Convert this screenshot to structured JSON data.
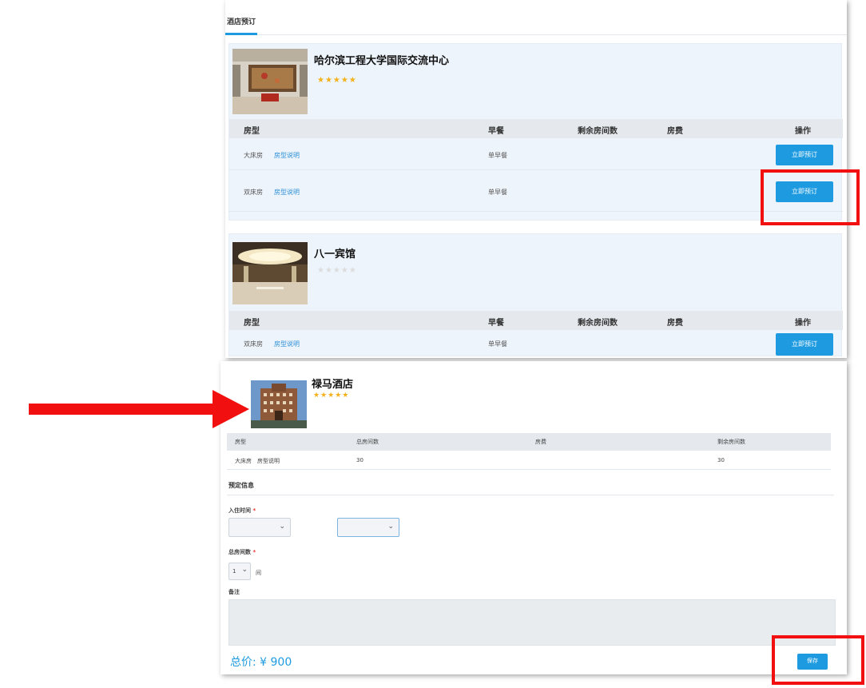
{
  "tabs": {
    "active": "酒店预订"
  },
  "room_columns": {
    "type": "房型",
    "breakfast": "早餐",
    "remaining": "剩余房间数",
    "price": "房费",
    "action": "操作"
  },
  "hotels": [
    {
      "name": "哈尔滨工程大学国际交流中心",
      "stars": "★★★★★",
      "rooms": [
        {
          "type": "大床房",
          "detail_link": "房型说明",
          "breakfast": "单早餐",
          "action": "立即预订"
        },
        {
          "type": "双床房",
          "detail_link": "房型说明",
          "breakfast": "单早餐",
          "action": "立即预订"
        }
      ]
    },
    {
      "name": "八一宾馆",
      "stars": "★★★★★",
      "rooms": [
        {
          "type": "双床房",
          "detail_link": "房型说明",
          "breakfast": "单早餐",
          "action": "立即预订"
        }
      ]
    }
  ],
  "booking": {
    "hotel_name": "禄马酒店",
    "stars": "★★★★★",
    "columns": {
      "type": "房型",
      "total": "总房间数",
      "price": "房费",
      "remaining": "剩余房间数"
    },
    "room": {
      "type": "大床房",
      "detail_link": "房型说明",
      "total": "30",
      "remaining": "30"
    },
    "section_title": "预定信息",
    "checkin_label": "入住时间",
    "required_mark": "*",
    "rooms_label": "总房间数",
    "rooms_value": "1",
    "rooms_unit": "间",
    "notes_label": "备注",
    "total_price": "总价: ¥ 900",
    "save_label": "保存"
  },
  "colors": {
    "accent": "#1e9be0",
    "annotation": "#f20f0f",
    "star": "#f2b11a"
  },
  "icons": {
    "select_chevron": "⌄"
  }
}
